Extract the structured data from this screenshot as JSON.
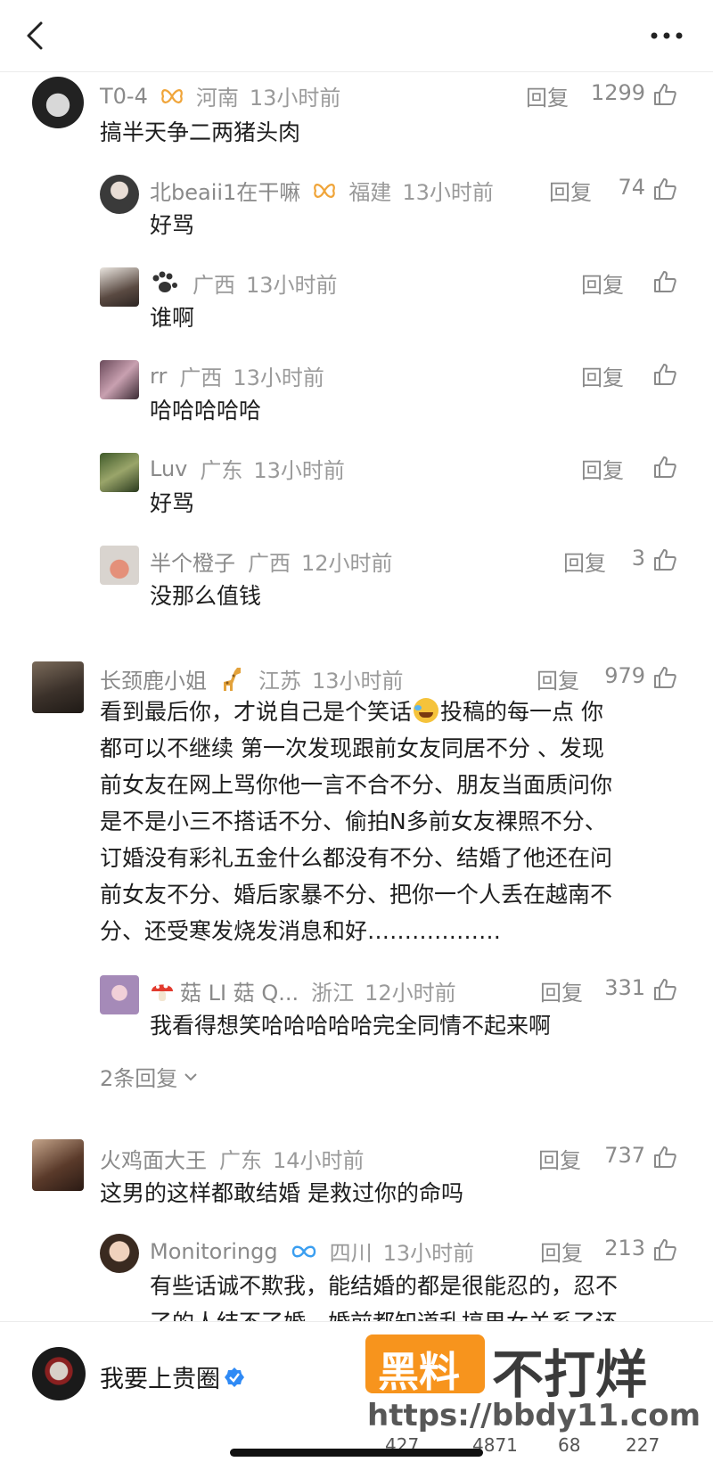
{
  "colors": {
    "text": "#1e1e1e",
    "meta": "#8a8a8a",
    "watermark_orange": "#f7941d",
    "verified_blue": "#2f8af5"
  },
  "icons": [
    "back-chevron-icon",
    "more-dots-icon",
    "like-thumb-icon",
    "butterfly-badge-icon",
    "paw-icon",
    "giraffe-emoji-icon",
    "laugh-cry-emoji-icon",
    "mushroom-emoji-icon",
    "infinity-badge-icon",
    "verified-badge-icon",
    "chevron-down-icon"
  ],
  "reply_label": "回复",
  "comments": [
    {
      "name": "T0-4",
      "loc": "河南",
      "time": "13小时前",
      "likes": "1299",
      "text": "搞半天争二两猪头肉"
    },
    {
      "name": "北beaii1在干嘛",
      "loc": "福建",
      "time": "13小时前",
      "likes": "74",
      "text": "好骂"
    },
    {
      "name": "",
      "loc": "广西",
      "time": "13小时前",
      "likes": "",
      "text": "谁啊"
    },
    {
      "name": "rr",
      "loc": "广西",
      "time": "13小时前",
      "likes": "",
      "text": "哈哈哈哈哈"
    },
    {
      "name": "Luv",
      "loc": "广东",
      "time": "13小时前",
      "likes": "",
      "text": "好骂"
    },
    {
      "name": "半个橙子",
      "loc": "广西",
      "time": "12小时前",
      "likes": "3",
      "text": "没那么值钱"
    },
    {
      "name": "长颈鹿小姐",
      "loc": "江苏",
      "time": "13小时前",
      "likes": "979",
      "lines": [
        "看到最后你，才说自己是个笑话",
        "投稿的每一点 你",
        "都可以不继续 第一次发现跟前女友同居不分 、发现",
        "前女友在网上骂你他一言不合不分、朋友当面质问你",
        "是不是小三不搭话不分、偷拍N多前女友裸照不分、",
        "订婚没有彩礼五金什么都没有不分、结婚了他还在问",
        "前女友不分、婚后家暴不分、把你一个人丢在越南不",
        "分、还受寒发烧发消息和好………………"
      ]
    },
    {
      "name": "菇 LI 菇 Q...",
      "loc": "浙江",
      "time": "12小时前",
      "likes": "331",
      "text": "我看得想笑哈哈哈哈哈完全同情不起来啊"
    },
    {
      "name": "火鸡面大王",
      "loc": "广东",
      "time": "14小时前",
      "likes": "737",
      "text": "这男的这样都敢结婚 是救过你的命吗"
    },
    {
      "name": "Monitoringg",
      "loc": "四川",
      "time": "13小时前",
      "likes": "213",
      "text": "有些话诚不欺我，能结婚的都是很能忍的，忍不",
      "text2": "了的人结不了婚。婚前都知道乱搞男女关系了还"
    }
  ],
  "more_replies": "2条回复",
  "bottom": {
    "author": "我要上贵圈",
    "stats": [
      "427",
      "4871",
      "68",
      "227"
    ]
  },
  "watermark": {
    "box": "黑料",
    "text": "不打烊",
    "url": "https://bbdy11.com"
  }
}
